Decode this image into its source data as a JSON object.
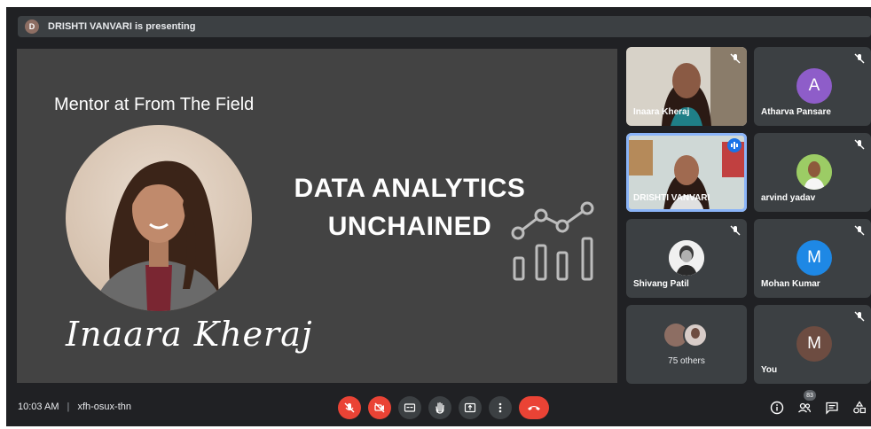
{
  "presenting_bar": {
    "avatar_letter": "D",
    "text": "DRISHTI VANVARI is presenting"
  },
  "slide": {
    "mentor_text": "Mentor at From The Field",
    "headline_line1": "DATA ANALYTICS",
    "headline_line2": "UNCHAINED",
    "signature": "Inaara Kheraj"
  },
  "participants": [
    {
      "name": "Inaara Kheraj",
      "type": "video",
      "muted": true
    },
    {
      "name": "Atharva Pansare",
      "type": "avatar",
      "letter": "A",
      "color": "#8e5dc9",
      "muted": true
    },
    {
      "name": "DRISHTI VANVARI",
      "type": "video",
      "active": true,
      "speaking": true
    },
    {
      "name": "arvind yadav",
      "type": "photo",
      "muted": true
    },
    {
      "name": "Shivang Patil",
      "type": "photo",
      "muted": true
    },
    {
      "name": "Mohan Kumar",
      "type": "avatar",
      "letter": "M",
      "color": "#1e88e5",
      "muted": true
    },
    {
      "name": "75 others",
      "type": "group"
    },
    {
      "name": "You",
      "type": "avatar",
      "letter": "M",
      "color": "#6d4c41",
      "muted": true
    }
  ],
  "bottom_bar": {
    "time": "10:03 AM",
    "separator": "|",
    "meeting_code": "xfh-osux-thn",
    "participant_count": "83",
    "icons": [
      "mic-off-icon",
      "camera-off-icon",
      "captions-icon",
      "raise-hand-icon",
      "present-icon",
      "more-vert-icon",
      "end-call-icon",
      "info-icon",
      "people-icon",
      "chat-icon",
      "activities-icon"
    ]
  },
  "colors": {
    "background": "#202124",
    "tile": "#3c4043",
    "slide": "#434343",
    "danger": "#ea4335",
    "active_outline": "#8ab4f8"
  }
}
